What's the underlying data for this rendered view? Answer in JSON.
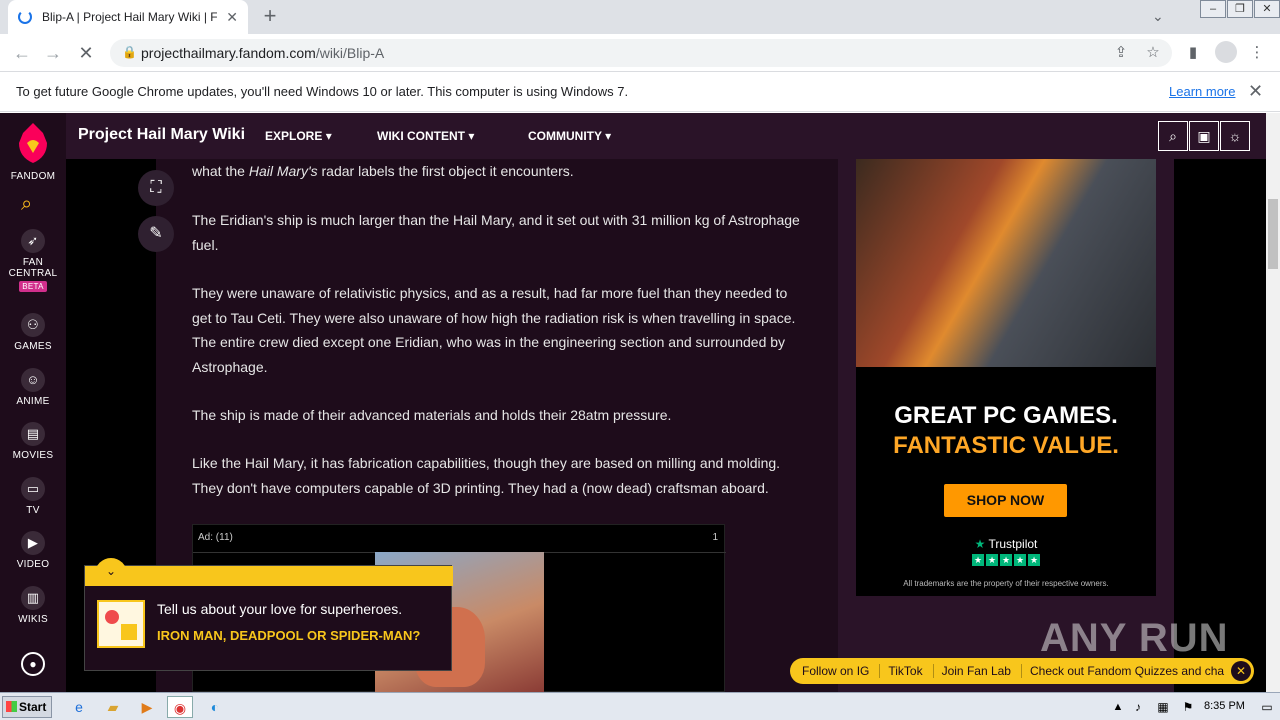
{
  "browser": {
    "tab_title": "Blip-A | Project Hail Mary Wiki | Fand",
    "url_host": "projecthailmary.fandom.com",
    "url_path": "/wiki/Blip-A",
    "infobar_message": "To get future Google Chrome updates, you'll need Windows 10 or later. This computer is using Windows 7.",
    "infobar_link": "Learn more"
  },
  "rail": {
    "logo_label": "FANDOM",
    "items": [
      {
        "label": "FAN",
        "label2": "CENTRAL",
        "badge": "BETA",
        "icon": "rocket-icon"
      },
      {
        "label": "GAMES",
        "icon": "gamepad-icon"
      },
      {
        "label": "ANIME",
        "icon": "anime-icon"
      },
      {
        "label": "MOVIES",
        "icon": "clapper-icon"
      },
      {
        "label": "TV",
        "icon": "tv-icon"
      },
      {
        "label": "VIDEO",
        "icon": "play-icon"
      },
      {
        "label": "WIKIS",
        "icon": "book-icon"
      }
    ]
  },
  "wiki": {
    "title": "Project Hail Mary Wiki",
    "nav": [
      "EXPLORE",
      "WIKI CONTENT",
      "COMMUNITY"
    ]
  },
  "article": {
    "p0_pre": "what the ",
    "p0_em": "Hail Mary's",
    "p0_post": " radar labels the first object it encounters.",
    "p1": "The Eridian's ship is much larger than the Hail Mary, and it set out with 31 million kg of Astrophage fuel.",
    "p2": "They were unaware of relativistic physics, and as a result, had far more fuel than they needed to get to Tau Ceti. They were also unaware of how high the radiation risk is when travelling in space. The entire crew died except one Eridian, who was in the engineering section and surrounded by Astrophage.",
    "p3": "The ship is made of their advanced materials and holds their 28atm pressure.",
    "p4": "Like the Hail Mary, it has fabrication capabilities, though they are based on milling and molding. They don't have computers capable of 3D printing. They had a (now dead) craftsman aboard."
  },
  "video_ad": {
    "label": "Ad: (11)",
    "count": "1"
  },
  "ad": {
    "headline1": "GREAT PC GAMES.",
    "headline2": "FANTASTIC VALUE.",
    "cta": "SHOP NOW",
    "trustpilot": "Trustpilot",
    "fine_print": "All trademarks are the property of their respective owners."
  },
  "quiz": {
    "question": "Tell us about your love for superheroes.",
    "answer": "IRON MAN, DEADPOOL OR SPIDER-MAN?"
  },
  "linkbar": [
    "Follow on IG",
    "TikTok",
    "Join Fan Lab",
    "Check out Fandom Quizzes and cha"
  ],
  "watermark": "ANY RUN",
  "taskbar": {
    "start": "Start",
    "clock": "8:35 PM"
  },
  "colors": {
    "fandom_yellow": "#f8c61c",
    "fandom_dark": "#1e0c1b",
    "link_blue": "#1a73e8"
  }
}
